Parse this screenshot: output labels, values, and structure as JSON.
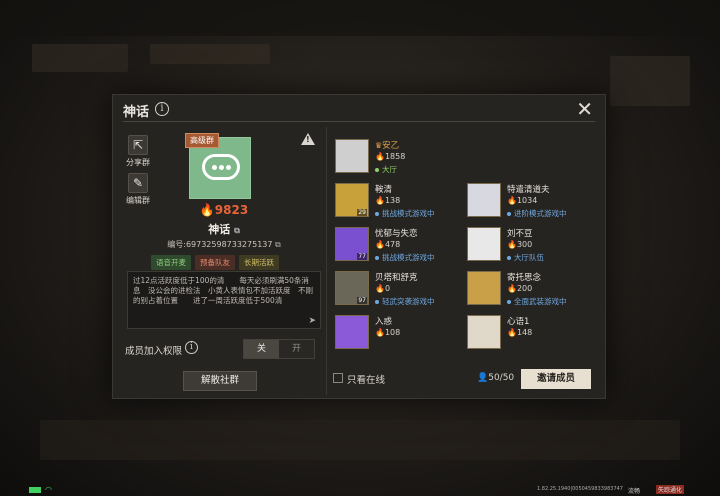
{
  "dialog": {
    "title": "神话",
    "close_label": "✕"
  },
  "side_buttons": [
    {
      "label": "分享群",
      "icon": "share-icon"
    },
    {
      "label": "编辑群",
      "icon": "edit-icon"
    }
  ],
  "group": {
    "grade_tag": "高级群",
    "heat": "9823",
    "name": "神话",
    "id_label": "编号:697325987332751​37",
    "tags": [
      "语音开麦",
      "预备队友",
      "长期活跃"
    ],
    "notice": "过12点活跃度低于100的清　　每天必须刷满50条消息　没公会的进检法　小黄人表情包不加活跃度　不刚的别占着位置　　进了一周活跃度低于500清"
  },
  "permission": {
    "label": "成员加入权限",
    "off_label": "关",
    "on_label": "开",
    "value": "关"
  },
  "disband_label": "解散社群",
  "members": [
    {
      "name": "安乙",
      "heat": "1858",
      "status": "大厅",
      "status_color": "#8fd064",
      "leader": true
    },
    {
      "name": "鞍清",
      "heat": "138",
      "status": "挑战模式游戏中",
      "status_color": "#6fa8e0",
      "lv": "29"
    },
    {
      "name": "特遣清道夫",
      "heat": "1034",
      "status": "进阶模式游戏中",
      "status_color": "#6fa8e0"
    },
    {
      "name": "忧郁与失恋",
      "heat": "478",
      "status": "挑战模式游戏中",
      "status_color": "#6fa8e0",
      "lv": "77"
    },
    {
      "name": "刘不豆",
      "heat": "300",
      "status": "大厅队伍",
      "status_color": "#6fa8e0"
    },
    {
      "name": "贝塔和舒克",
      "heat": "0",
      "status": "轻武突袭游戏中",
      "status_color": "#6fa8e0",
      "lv": "97"
    },
    {
      "name": "寄托思念",
      "heat": "200",
      "status": "全面武装游戏中",
      "status_color": "#6fa8e0"
    },
    {
      "name": "入惑",
      "heat": "108",
      "status": "",
      "status_color": "#6fa8e0"
    },
    {
      "name": "心语1",
      "heat": "148",
      "status": "",
      "status_color": "#6fa8e0"
    }
  ],
  "footer": {
    "online_only_label": "只看在线",
    "member_count": "50/50",
    "invite_label": "邀请成员"
  },
  "status_bar": {
    "version": "1.82.25.1940|0050459833983747",
    "signal": "流畅",
    "network": "失踪通化"
  }
}
